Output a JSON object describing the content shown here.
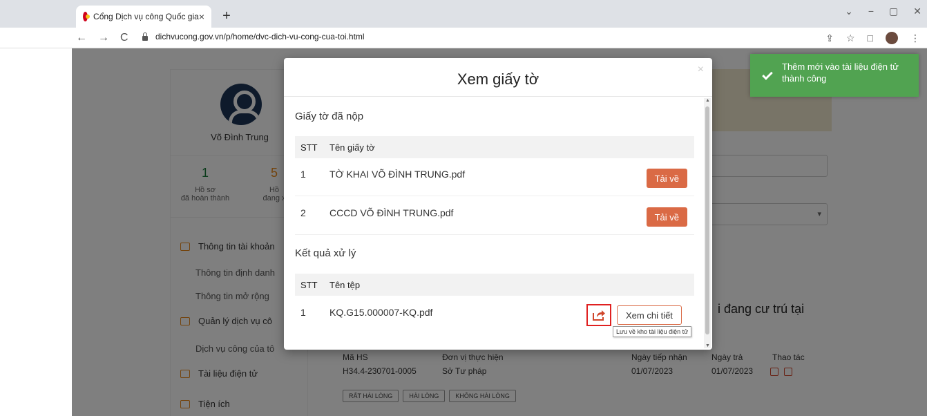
{
  "browser": {
    "tab_title": "Cổng Dịch vụ công Quốc gia",
    "tab_close": "×",
    "new_tab": "+",
    "url": "dichvucong.gov.vn/p/home/dvc-dich-vu-cong-cua-toi.html",
    "nav_back": "←",
    "nav_forward": "→",
    "nav_reload": "C",
    "share_icon": "⇪",
    "star_icon": "☆",
    "sidepanel_icon": "□",
    "menu_icon": "⋮",
    "win_min": "−",
    "win_max": "▢",
    "win_close": "✕",
    "tab_list": "⌄"
  },
  "sidebar": {
    "user_name": "Võ Đình Trung",
    "stat1_value": "1",
    "stat1_label1": "Hồ sơ",
    "stat1_label2": "đã hoàn thành",
    "stat2_value": "5",
    "stat2_label1": "Hồ",
    "stat2_label2": "đang x",
    "menu": [
      {
        "label": "Thông tin tài khoản"
      },
      {
        "label": "Quản lý dịch vụ cô"
      },
      {
        "label": "Tài liệu điện tử"
      },
      {
        "label": "Tiện ích"
      }
    ],
    "submenu": [
      {
        "label": "Thông tin định danh"
      },
      {
        "label": "Thông tin mở rộng"
      },
      {
        "label": "Dịch vụ công của tô"
      }
    ]
  },
  "background": {
    "heading": "i đang cư trú tại",
    "cols": [
      "Mã HS",
      "Đơn vị thực hiện",
      "Ngày tiếp nhận",
      "Ngày trả",
      "Thao tác"
    ],
    "row": [
      "H34.4-230701-0005",
      "Sở Tư pháp",
      "01/07/2023",
      "01/07/2023"
    ],
    "satisfaction": [
      "RẤT HÀI LÒNG",
      "HÀI LÒNG",
      "KHÔNG HÀI LÒNG"
    ]
  },
  "toast": {
    "message": "Thêm mới vào tài liệu điện tử thành công"
  },
  "modal": {
    "title": "Xem giấy tờ",
    "close": "×",
    "submitted": {
      "title": "Giấy tờ đã nộp",
      "col_stt": "STT",
      "col_name": "Tên giấy tờ",
      "rows": [
        {
          "stt": "1",
          "name": "TỜ KHAI VÕ ĐÌNH TRUNG.pdf",
          "action": "Tải về"
        },
        {
          "stt": "2",
          "name": "CCCD VÕ ĐÌNH TRUNG.pdf",
          "action": "Tải về"
        }
      ]
    },
    "result": {
      "title": "Kết quả xử lý",
      "col_stt": "STT",
      "col_name": "Tên tệp",
      "rows": [
        {
          "stt": "1",
          "name": "KQ.G15.000007-KQ.pdf",
          "action": "Xem chi tiết"
        }
      ],
      "tooltip": "Lưu về kho tài liệu điện tử"
    }
  },
  "colors": {
    "accent": "#da6a45",
    "toast": "#51a351",
    "highlight": "#e02020"
  }
}
